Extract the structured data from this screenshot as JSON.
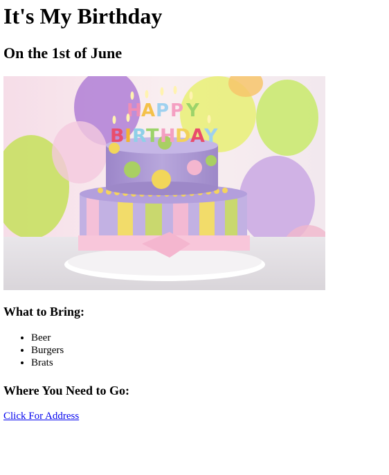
{
  "page": {
    "title": "It's My Birthday",
    "subtitle": "On the 1st of June"
  },
  "hero_image": {
    "icon": "birthday-cake-image",
    "cake_topper_text": "HAPPY BIRTHDAY"
  },
  "bring": {
    "heading": "What to Bring:",
    "items": [
      "Beer",
      "Burgers",
      "Brats"
    ]
  },
  "location": {
    "heading": "Where You Need to Go:",
    "link_label": "Click For Address"
  },
  "colors": {
    "link": "#0000ee",
    "text": "#000000"
  }
}
